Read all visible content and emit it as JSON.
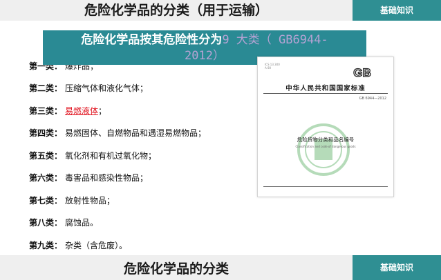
{
  "header": {
    "title": "危险化学品的分类（用于运输）",
    "badge": "基础知识"
  },
  "banner": {
    "prefix": "危险化学品按其危险性分为",
    "highlight_line1": "9 大类（ GB6944-",
    "highlight_line2": "2012）"
  },
  "classes": [
    {
      "label": "第一类：",
      "text": "爆炸品；"
    },
    {
      "label": "第二类：",
      "text": "压缩气体和液化气体；"
    },
    {
      "label": "第三类：",
      "text": "易燃液体",
      "suffix": "；",
      "color": "#e0101c"
    },
    {
      "label": "第四类：",
      "text": "易燃固体、自燃物品和遇湿易燃物品；"
    },
    {
      "label": "第五类：",
      "text": "氧化剂和有机过氧化物；"
    },
    {
      "label": "第六类：",
      "text": "毒害品和感染性物品；"
    },
    {
      "label": "第七类：",
      "text": "放射性物品；"
    },
    {
      "label": "第八类：",
      "text": "腐蚀品。"
    },
    {
      "label": "第九类：",
      "text": "杂类（含危废）。"
    }
  ],
  "document": {
    "logo": "GB",
    "title": "中华人民共和国国家标准",
    "code": "GB 6944—2012",
    "name": "危险货物分类和品名编号",
    "name_en": "Classification and code of dangerous goods"
  },
  "footer": {
    "title": "危险化学品的分类",
    "badge": "基础知识"
  },
  "colors": {
    "accent": "#2f8f93",
    "banner": "#2a8a94",
    "highlight": "#b6a3d4",
    "emphasis": "#e0101c"
  }
}
